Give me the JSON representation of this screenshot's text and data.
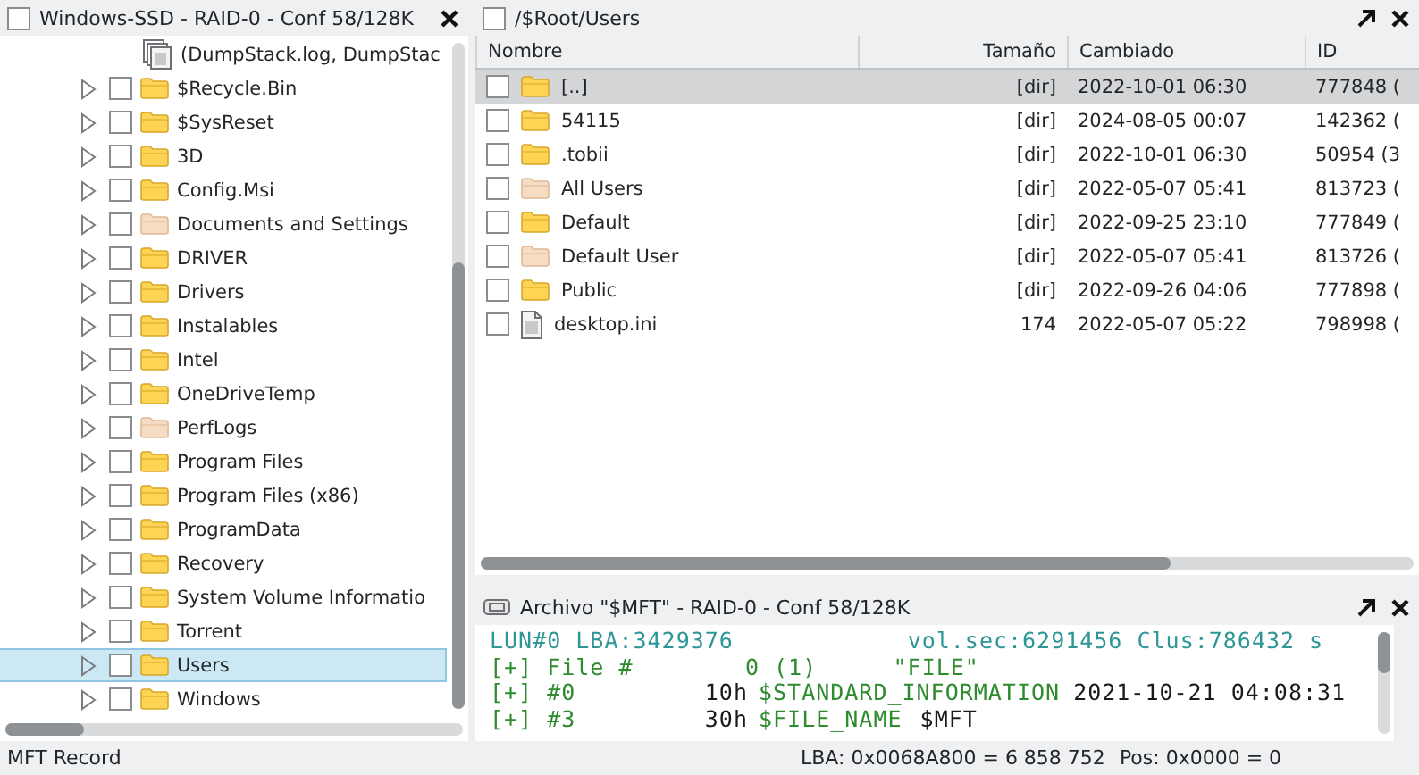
{
  "tree_panel": {
    "title": "Windows-SSD - RAID-0 - Conf 58/128K",
    "checked": false,
    "items": [
      {
        "kind": "files",
        "label": "(DumpStack.log, DumpStac",
        "selected": false
      },
      {
        "kind": "folder",
        "label": "$Recycle.Bin",
        "hidden": false,
        "checked": false,
        "selected": false
      },
      {
        "kind": "folder",
        "label": "$SysReset",
        "hidden": false,
        "checked": false,
        "selected": false
      },
      {
        "kind": "folder",
        "label": "3D",
        "hidden": false,
        "checked": false,
        "selected": false
      },
      {
        "kind": "folder",
        "label": "Config.Msi",
        "hidden": false,
        "checked": false,
        "selected": false
      },
      {
        "kind": "folder",
        "label": "Documents and Settings",
        "hidden": true,
        "checked": false,
        "selected": false
      },
      {
        "kind": "folder",
        "label": "DRIVER",
        "hidden": false,
        "checked": false,
        "selected": false
      },
      {
        "kind": "folder",
        "label": "Drivers",
        "hidden": false,
        "checked": false,
        "selected": false
      },
      {
        "kind": "folder",
        "label": "Instalables",
        "hidden": false,
        "checked": false,
        "selected": false
      },
      {
        "kind": "folder",
        "label": "Intel",
        "hidden": false,
        "checked": false,
        "selected": false
      },
      {
        "kind": "folder",
        "label": "OneDriveTemp",
        "hidden": false,
        "checked": false,
        "selected": false
      },
      {
        "kind": "folder",
        "label": "PerfLogs",
        "hidden": true,
        "checked": false,
        "selected": false
      },
      {
        "kind": "folder",
        "label": "Program Files",
        "hidden": false,
        "checked": false,
        "selected": false
      },
      {
        "kind": "folder",
        "label": "Program Files (x86)",
        "hidden": false,
        "checked": false,
        "selected": false
      },
      {
        "kind": "folder",
        "label": "ProgramData",
        "hidden": false,
        "checked": false,
        "selected": false
      },
      {
        "kind": "folder",
        "label": "Recovery",
        "hidden": false,
        "checked": false,
        "selected": false
      },
      {
        "kind": "folder",
        "label": "System Volume Informatio",
        "hidden": false,
        "checked": false,
        "selected": false
      },
      {
        "kind": "folder",
        "label": "Torrent",
        "hidden": false,
        "checked": false,
        "selected": false
      },
      {
        "kind": "folder",
        "label": "Users",
        "hidden": false,
        "checked": false,
        "selected": true
      },
      {
        "kind": "folder",
        "label": "Windows",
        "hidden": false,
        "checked": false,
        "selected": false
      }
    ]
  },
  "list_panel": {
    "title": "/$Root/Users",
    "checked": false,
    "columns": [
      "Nombre",
      "Tamaño",
      "Cambiado",
      "ID"
    ],
    "rows": [
      {
        "kind": "folder",
        "name": "[..]",
        "size": "[dir]",
        "changed": "2022-10-01 06:30",
        "id": "777848 (",
        "hidden": false,
        "checked": false,
        "selected": true
      },
      {
        "kind": "folder",
        "name": "54115",
        "size": "[dir]",
        "changed": "2024-08-05 00:07",
        "id": "142362 (",
        "hidden": false,
        "checked": false,
        "selected": false
      },
      {
        "kind": "folder",
        "name": ".tobii",
        "size": "[dir]",
        "changed": "2022-10-01 06:30",
        "id": "50954 (3",
        "hidden": false,
        "checked": false,
        "selected": false
      },
      {
        "kind": "folder",
        "name": "All Users",
        "size": "[dir]",
        "changed": "2022-05-07 05:41",
        "id": "813723 (",
        "hidden": true,
        "checked": false,
        "selected": false
      },
      {
        "kind": "folder",
        "name": "Default",
        "size": "[dir]",
        "changed": "2022-09-25 23:10",
        "id": "777849 (",
        "hidden": false,
        "checked": false,
        "selected": false
      },
      {
        "kind": "folder",
        "name": "Default User",
        "size": "[dir]",
        "changed": "2022-05-07 05:41",
        "id": "813726 (",
        "hidden": true,
        "checked": false,
        "selected": false
      },
      {
        "kind": "folder",
        "name": "Public",
        "size": "[dir]",
        "changed": "2022-09-26 04:06",
        "id": "777898 (",
        "hidden": false,
        "checked": false,
        "selected": false
      },
      {
        "kind": "file",
        "name": "desktop.ini",
        "size": "174",
        "changed": "2022-05-07 05:22",
        "id": "798998 (",
        "checked": false,
        "selected": false
      }
    ]
  },
  "record_panel": {
    "title": "Archivo \"$MFT\" - RAID-0 - Conf 58/128K",
    "lines": [
      {
        "kind": "header",
        "segments": [
          {
            "text": "LUN#0 LBA:3429376",
            "color": "#2f9696"
          },
          {
            "text": "vol.sec:6291456 Clus:786432 s",
            "color": "#2f9696"
          }
        ]
      },
      {
        "kind": "file",
        "segments": [
          {
            "text": "[+] File #",
            "color": "#2e8b2e"
          },
          {
            "text": "0 (1)",
            "color": "#2e8b2e"
          },
          {
            "text": "\"FILE\"",
            "color": "#2e8b2e"
          }
        ]
      },
      {
        "kind": "attr",
        "segments": [
          {
            "text": "[+] #0",
            "color": "#2e8b2e"
          },
          {
            "text": "10h",
            "color": "#1a1a1a"
          },
          {
            "text": "$STANDARD_INFORMATION",
            "color": "#2e8b2e"
          },
          {
            "text": "2021-10-21 04:08:31",
            "color": "#1a1a1a"
          }
        ]
      },
      {
        "kind": "attr",
        "segments": [
          {
            "text": "[+] #3",
            "color": "#2e8b2e"
          },
          {
            "text": "30h",
            "color": "#1a1a1a"
          },
          {
            "text": "$FILE_NAME",
            "color": "#2e8b2e"
          },
          {
            "text": "$MFT",
            "color": "#1a1a1a"
          }
        ]
      }
    ]
  },
  "status_bar": {
    "left": "MFT Record",
    "lba": "LBA: 0x0068A800 = 6 858 752",
    "pos": "Pos: 0x0000 = 0"
  }
}
